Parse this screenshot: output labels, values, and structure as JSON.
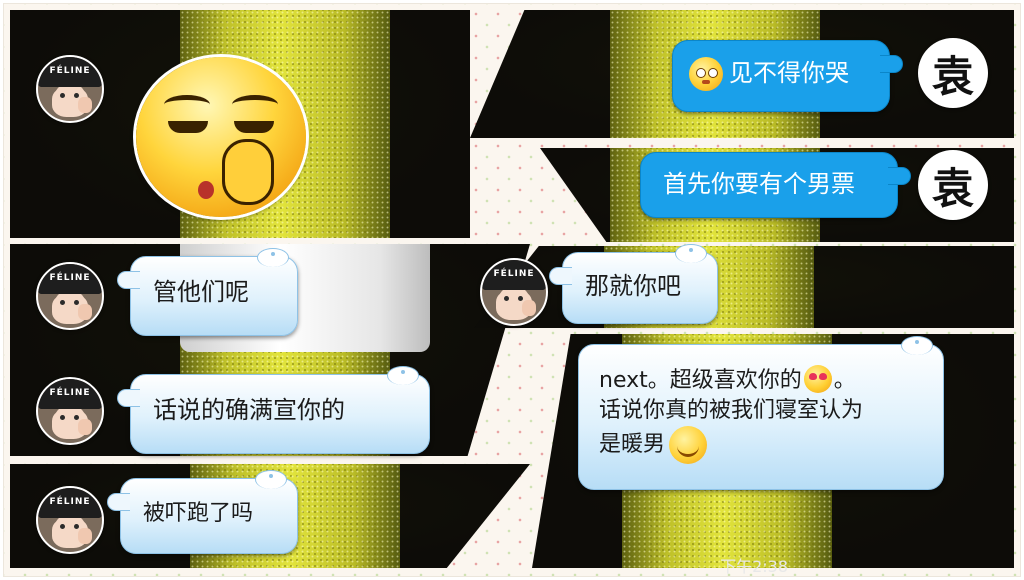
{
  "messages": {
    "m1": "见不得你哭",
    "m2": "首先你要有个男票",
    "m3": "管他们呢",
    "m4": "那就你吧",
    "m5": "话说的确满宣你的",
    "m6_line1a": "next。超级喜欢你的",
    "m6_line1b": "。",
    "m6_line2": "话说你真的被我们寝室认为",
    "m6_line3": "是暖男",
    "m7": "被吓跑了吗"
  },
  "avatar": {
    "cap_text": "FÉLINE"
  },
  "stamp_char": "袁",
  "time": "下午2:38",
  "colors": {
    "outgoing_bubble": "#1aa0ea",
    "incoming_bubble": "#dff1fc",
    "frame_background": "#fbf6ef"
  },
  "icons": [
    "sleepy-pick-nose-emoji",
    "angry-face-emoji",
    "heart-eyes-emoji",
    "smile-emoji"
  ]
}
